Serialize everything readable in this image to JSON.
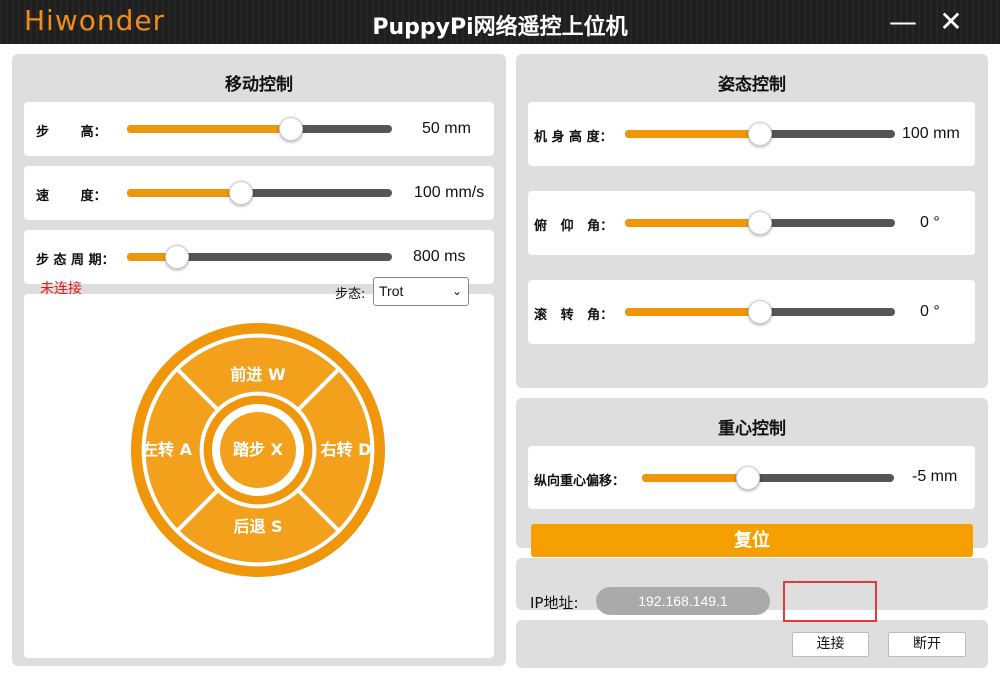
{
  "window": {
    "logo": "Hiwonder",
    "title": "PuppyPi网络遥控上位机",
    "minimize": "—",
    "close": "✕"
  },
  "motion": {
    "title": "移动控制",
    "sliders": [
      {
        "label": "步       高：",
        "value": "50 mm",
        "level": 0.62
      },
      {
        "label": "速       度：",
        "value": "100 mm/s",
        "level": 0.43
      },
      {
        "label": "步 态 周 期：",
        "value": "800 ms",
        "level": 0.19
      }
    ],
    "status": "未连接",
    "gait_label": "步态:",
    "gait_value": "Trot",
    "pad": {
      "forward": "前进 W",
      "back": "后退 S",
      "left": "左转 A",
      "right": "右转 D",
      "center": "踏步 X"
    }
  },
  "posture": {
    "title": "姿态控制",
    "sliders": [
      {
        "label": "机 身 高 度：",
        "value": "100 mm",
        "level": 0.5
      },
      {
        "label": "俯   仰   角：",
        "value": "0 °",
        "level": 0.5
      },
      {
        "label": "滚   转   角：",
        "value": "0 °",
        "level": 0.5
      }
    ]
  },
  "gravity": {
    "title": "重心控制",
    "sliders": [
      {
        "label": "纵向重心偏移：",
        "value": "-5 mm",
        "level": 0.42
      }
    ]
  },
  "reset_label": "复位",
  "connection": {
    "ip_label": "IP地址:",
    "ip_value": "192.168.149.1",
    "connect_label": "连接",
    "disconnect_label": "断开"
  },
  "colors": {
    "accent": "#f0960a",
    "track": "#555555",
    "status_disconnected": "#e01b1b"
  }
}
